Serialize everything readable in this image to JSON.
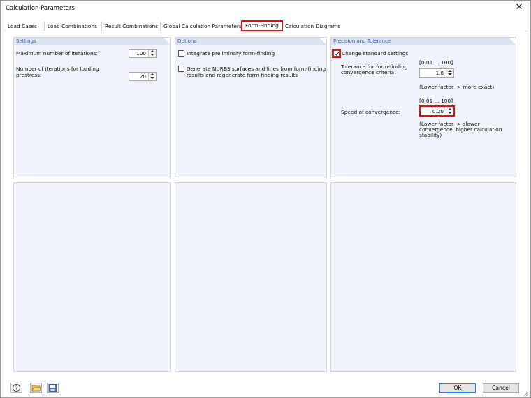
{
  "window": {
    "title": "Calculation Parameters",
    "close_glyph": "✕"
  },
  "tabs": [
    {
      "label": "Load Cases"
    },
    {
      "label": "Load Combinations"
    },
    {
      "label": "Result Combinations"
    },
    {
      "label": "Global Calculation Parameters"
    },
    {
      "label": "Form-Finding",
      "active": true
    },
    {
      "label": "Calculation Diagrams"
    }
  ],
  "settings": {
    "title": "Settings",
    "max_iterations_label": "Maximum number of iterations:",
    "max_iterations_value": "100",
    "loading_prestress_label_1": "Number of iterations for loading",
    "loading_prestress_label_2": "prestress:",
    "loading_prestress_value": "20"
  },
  "options": {
    "title": "Options",
    "integrate_label": "Integrate preliminary form-finding",
    "integrate_checked": false,
    "nurbs_label_1": "Generate NURBS surfaces and lines from form-finding",
    "nurbs_label_2": "results and regenerate form-finding results",
    "nurbs_checked": false
  },
  "precision": {
    "title": "Precision and Tolerance",
    "change_label": "Change standard settings",
    "change_checked": true,
    "tolerance_range": "[0.01 ... 100]",
    "tolerance_label_1": "Tolerance for form-finding",
    "tolerance_label_2": "convergence criteria:",
    "tolerance_value": "1.0",
    "tolerance_hint": "(Lower factor -> more exact)",
    "speed_range": "[0.01 ... 100]",
    "speed_label": "Speed of convergence:",
    "speed_value": "0.20",
    "speed_hint_1": "(Lower factor -> slower",
    "speed_hint_2": "convergence, higher calculation",
    "speed_hint_3": "stability)"
  },
  "buttons": {
    "ok": "OK",
    "cancel": "Cancel"
  },
  "icons": [
    "help-icon",
    "open-folder-icon",
    "save-icon"
  ],
  "colors": {
    "highlight": "#e01010",
    "panel_bg": "#f0f3f9",
    "panel_header": "#dbe3f1",
    "panel_title": "#3b5ea8"
  }
}
